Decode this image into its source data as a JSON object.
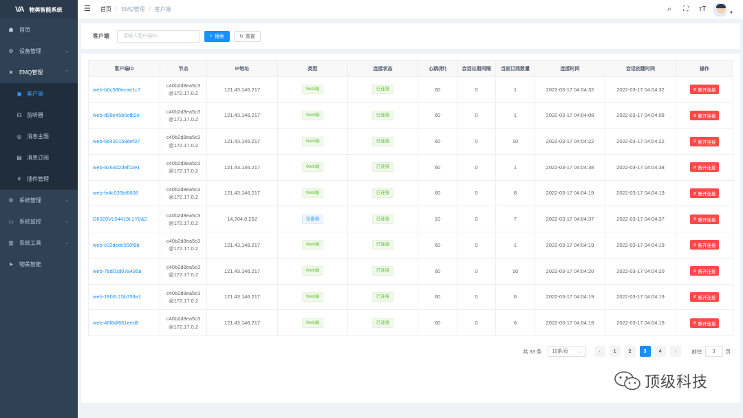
{
  "app": {
    "logo_mark": "VA",
    "title": "物美智能系统"
  },
  "sidebar": {
    "items": [
      {
        "label": "首页",
        "icon": "dashboard-icon",
        "glyph": "☗"
      },
      {
        "label": "设备管理",
        "icon": "device-gear-icon",
        "glyph": "⚙"
      },
      {
        "label": "EMQ管理",
        "icon": "tool-icon",
        "glyph": "✕"
      }
    ],
    "sub_items": [
      {
        "label": "客户端",
        "icon": "monitor-icon",
        "glyph": "▣"
      },
      {
        "label": "监听器",
        "icon": "headset-icon",
        "glyph": "☊"
      },
      {
        "label": "消息主题",
        "icon": "topic-icon",
        "glyph": "◎"
      },
      {
        "label": "消息订阅",
        "icon": "subscription-icon",
        "glyph": "▤"
      },
      {
        "label": "插件管理",
        "icon": "plugin-icon",
        "glyph": "⚘"
      }
    ],
    "items_bottom": [
      {
        "label": "系统管理",
        "icon": "system-gear-icon",
        "glyph": "⚙"
      },
      {
        "label": "系统监控",
        "icon": "monitor-screen-icon",
        "glyph": "▭"
      },
      {
        "label": "系统工具",
        "icon": "toolbox-icon",
        "glyph": "▥"
      },
      {
        "label": "物美智能",
        "icon": "send-icon",
        "glyph": "➤"
      }
    ]
  },
  "header": {
    "breadcrumb": [
      "首页",
      "EMQ管理",
      "客户端"
    ],
    "tools": [
      "search-icon",
      "fullscreen-icon",
      "font-size-icon"
    ]
  },
  "search": {
    "label": "客户端",
    "placeholder": "请输入客户端ID",
    "value": "",
    "search_button": "搜索",
    "reset_button": "重置"
  },
  "table": {
    "columns": [
      "客户端ID",
      "节点",
      "IP地址",
      "类型",
      "连接状态",
      "心跳(秒)",
      "会话过期间隔",
      "当前订阅数量",
      "连接时间",
      "会话创建时间",
      "操作"
    ],
    "action_label": "断开连接",
    "rows": [
      {
        "id": "web-b0c580ecae1c7",
        "node1": "c40b2d8ea5c3",
        "node2": "@172.17.0.2",
        "ip": "121.43.146.217",
        "type": "Web端",
        "type_kind": "web",
        "status": "已连接",
        "heartbeat": "60",
        "expiry": "0",
        "subs": "1",
        "connected_at": "2022-03-17 04:04:32",
        "created_at": "2022-03-17 04:04:32"
      },
      {
        "id": "web-d98e45b5cfb2e",
        "node1": "c40b2d8ea5c3",
        "node2": "@172.17.0.2",
        "ip": "121.43.146.217",
        "type": "Web端",
        "type_kind": "web",
        "status": "已连接",
        "heartbeat": "60",
        "expiry": "0",
        "subs": "1",
        "connected_at": "2022-03-17 04:04:08",
        "created_at": "2022-03-17 04:04:08"
      },
      {
        "id": "web-6d430159def37",
        "node1": "c40b2d8ea5c3",
        "node2": "@172.17.0.2",
        "ip": "121.43.146.217",
        "type": "Web端",
        "type_kind": "web",
        "status": "已连接",
        "heartbeat": "60",
        "expiry": "0",
        "subs": "10",
        "connected_at": "2022-03-17 04:04:22",
        "created_at": "2022-03-17 04:04:22"
      },
      {
        "id": "web-9263d2d9f02e1",
        "node1": "c40b2d8ea5c3",
        "node2": "@172.17.0.2",
        "ip": "121.43.146.217",
        "type": "Web端",
        "type_kind": "web",
        "status": "已连接",
        "heartbeat": "60",
        "expiry": "0",
        "subs": "1",
        "connected_at": "2022-03-17 04:04:38",
        "created_at": "2022-03-17 04:04:38"
      },
      {
        "id": "web-fe4c033bf6608",
        "node1": "c40b2d8ea5c3",
        "node2": "@172.17.0.2",
        "ip": "121.43.146.217",
        "type": "Web端",
        "type_kind": "web",
        "status": "已连接",
        "heartbeat": "60",
        "expiry": "0",
        "subs": "8",
        "connected_at": "2022-03-17 04:04:19",
        "created_at": "2022-03-17 04:04:19"
      },
      {
        "id": "D6329VL54419L1Y0&2",
        "node1": "c40b2d8ea5c3",
        "node2": "@172.17.0.2",
        "ip": "14.204.0.252",
        "type": "设备端",
        "type_kind": "device",
        "status": "已连接",
        "heartbeat": "10",
        "expiry": "0",
        "subs": "7",
        "connected_at": "2022-03-17 04:04:37",
        "created_at": "2022-03-17 04:04:37"
      },
      {
        "id": "web-c02dedc550f9b",
        "node1": "c40b2d8ea5c3",
        "node2": "@172.17.0.2",
        "ip": "121.43.146.217",
        "type": "Web端",
        "type_kind": "web",
        "status": "已连接",
        "heartbeat": "60",
        "expiry": "0",
        "subs": "1",
        "connected_at": "2022-03-17 04:04:19",
        "created_at": "2022-03-17 04:04:19"
      },
      {
        "id": "web-7bd01d87a495a",
        "node1": "c40b2d8ea5c3",
        "node2": "@172.17.0.2",
        "ip": "121.43.146.217",
        "type": "Web端",
        "type_kind": "web",
        "status": "已连接",
        "heartbeat": "60",
        "expiry": "0",
        "subs": "10",
        "connected_at": "2022-03-17 04:04:20",
        "created_at": "2022-03-17 04:04:20"
      },
      {
        "id": "web-1902c15b759a1",
        "node1": "c40b2d8ea5c3",
        "node2": "@172.17.0.2",
        "ip": "121.43.146.217",
        "type": "Web端",
        "type_kind": "web",
        "status": "已连接",
        "heartbeat": "60",
        "expiry": "0",
        "subs": "6",
        "connected_at": "2022-03-17 04:04:19",
        "created_at": "2022-03-17 04:04:19"
      },
      {
        "id": "web-40f6df661eed8",
        "node1": "c40b2d8ea5c3",
        "node2": "@172.17.0.2",
        "ip": "121.43.146.217",
        "type": "Web端",
        "type_kind": "web",
        "status": "已连接",
        "heartbeat": "60",
        "expiry": "0",
        "subs": "6",
        "connected_at": "2022-03-17 04:04:19",
        "created_at": "2022-03-17 04:04:19"
      }
    ]
  },
  "pagination": {
    "total_text": "共 33 条",
    "page_size": "10条/页",
    "pages": [
      "1",
      "2",
      "3",
      "4"
    ],
    "current": "3",
    "goto_label": "前往",
    "goto_value": "3",
    "goto_suffix": "页"
  },
  "watermark": {
    "text": "顶级科技"
  },
  "colors": {
    "sidebar": "#304156",
    "primary": "#1890ff",
    "danger": "#ff4949",
    "success": "#67c23a"
  }
}
